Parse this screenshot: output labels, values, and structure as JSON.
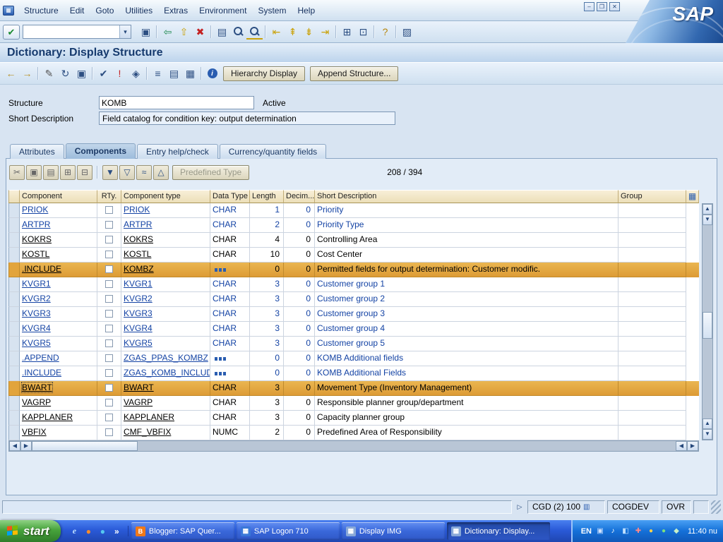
{
  "window": {
    "logo_text": "SAP",
    "controls": [
      {
        "name": "minimize-button",
        "glyph": "–"
      },
      {
        "name": "restore-button",
        "glyph": "❐"
      },
      {
        "name": "close-button",
        "glyph": "✕"
      }
    ]
  },
  "menubar": {
    "items": [
      "Structure",
      "Edit",
      "Goto",
      "Utilities",
      "Extras",
      "Environment",
      "System",
      "Help"
    ]
  },
  "toolbar": {
    "enter_glyph": "✔",
    "command_value": "",
    "dropdown_glyph": "▾",
    "icons": [
      {
        "name": "save-icon",
        "glyph": "▣",
        "color": "#2d4f82"
      },
      {
        "sep": true
      },
      {
        "name": "back-icon",
        "glyph": "⇦",
        "color": "#1e8a50"
      },
      {
        "name": "exit-icon",
        "glyph": "⇧",
        "color": "#caa20a"
      },
      {
        "name": "cancel-icon",
        "glyph": "✖",
        "color": "#c42222"
      },
      {
        "sep": true
      },
      {
        "name": "print-icon",
        "glyph": "▤",
        "color": "#2d4f82"
      },
      {
        "name": "find-icon",
        "css": "mag"
      },
      {
        "name": "find-next-icon",
        "css": "mag plus"
      },
      {
        "sep": true
      },
      {
        "name": "first-page-icon",
        "glyph": "⇤",
        "color": "#caa20a"
      },
      {
        "name": "previous-page-icon",
        "glyph": "⇞",
        "color": "#caa20a"
      },
      {
        "name": "next-page-icon",
        "glyph": "⇟",
        "color": "#caa20a"
      },
      {
        "name": "last-page-icon",
        "glyph": "⇥",
        "color": "#caa20a"
      },
      {
        "sep": true
      },
      {
        "name": "new-session-icon",
        "glyph": "⊞",
        "color": "#2d4f82"
      },
      {
        "name": "create-shortcut-icon",
        "glyph": "⊡",
        "color": "#2d4f82"
      },
      {
        "sep": true
      },
      {
        "name": "help-icon",
        "glyph": "?",
        "color": "#b8860b"
      },
      {
        "sep": true
      },
      {
        "name": "layout-menu-icon",
        "glyph": "▨",
        "color": "#2d4f82"
      }
    ]
  },
  "page": {
    "title": "Dictionary: Display Structure"
  },
  "app_toolbar": {
    "icons": [
      {
        "name": "back-icon",
        "glyph": "←",
        "color": "#b8922a"
      },
      {
        "name": "forward-icon",
        "glyph": "→",
        "color": "#b8922a"
      },
      {
        "sep": true
      },
      {
        "name": "display-change-icon",
        "glyph": "✎",
        "color": "#555555"
      },
      {
        "name": "refresh-icon",
        "glyph": "↻",
        "color": "#2d4f82"
      },
      {
        "name": "copy-icon",
        "glyph": "▣",
        "color": "#2d4f82"
      },
      {
        "sep": true
      },
      {
        "name": "check-icon",
        "glyph": "✔",
        "color": "#2d4f82"
      },
      {
        "name": "activate-icon",
        "glyph": "!",
        "color": "#c42222"
      },
      {
        "name": "where-used-icon",
        "glyph": "◈",
        "color": "#2d4f82"
      },
      {
        "sep": true
      },
      {
        "name": "runtime-object-icon",
        "glyph": "≡",
        "color": "#2d4f82"
      },
      {
        "name": "indexes-icon",
        "glyph": "▤",
        "color": "#2d4f82"
      },
      {
        "name": "technical-settings-icon",
        "glyph": "▦",
        "color": "#2d4f82"
      },
      {
        "sep": true
      },
      {
        "name": "info-icon",
        "css": "info"
      }
    ],
    "hierarchy_button": "Hierarchy Display",
    "append_button": "Append Structure..."
  },
  "form": {
    "structure_label": "Structure",
    "structure_value": "KOMB",
    "active_label": "Active",
    "short_desc_label": "Short Description",
    "short_desc_value": "Field catalog for condition key: output determination"
  },
  "tabs": {
    "items": [
      "Attributes",
      "Components",
      "Entry help/check",
      "Currency/quantity fields"
    ],
    "active_index": 1
  },
  "components_toolbar": {
    "icons": [
      {
        "name": "cut-icon",
        "glyph": "✂",
        "color": "#666666"
      },
      {
        "name": "copy-icon",
        "glyph": "▣",
        "color": "#666666"
      },
      {
        "name": "paste-icon",
        "glyph": "▤",
        "color": "#666666"
      },
      {
        "name": "insert-row-icon",
        "glyph": "⊞",
        "color": "#666666"
      },
      {
        "name": "delete-row-icon",
        "glyph": "⊟",
        "color": "#666666"
      },
      {
        "sep": true
      },
      {
        "name": "select-all-icon",
        "glyph": "▼",
        "color": "#2d4f82"
      },
      {
        "name": "filter-icon",
        "glyph": "▽",
        "color": "#2d4f82"
      },
      {
        "name": "sort-icon",
        "glyph": "≈",
        "color": "#2d4f82"
      },
      {
        "name": "move-up-icon",
        "glyph": "△",
        "color": "#2d4f82"
      }
    ],
    "predefined_type_label": "Predefined Type",
    "position": "208 / 394"
  },
  "table": {
    "headers": [
      "Component",
      "RTy.",
      "Component type",
      "Data Type",
      "Length",
      "Decim...",
      "Short Description",
      "Group"
    ],
    "settings_glyph": "▦",
    "rows": [
      {
        "component": "PRIOK",
        "rty": false,
        "ctype": "PRIOK",
        "dtype": "CHAR",
        "dtype_icon": false,
        "length": "1",
        "decimals": "0",
        "description": "Priority",
        "color": "blue",
        "highlight": false,
        "selected": false
      },
      {
        "component": "ARTPR",
        "rty": false,
        "ctype": "ARTPR",
        "dtype": "CHAR",
        "dtype_icon": false,
        "length": "2",
        "decimals": "0",
        "description": "Priority Type",
        "color": "blue",
        "highlight": false,
        "selected": false
      },
      {
        "component": "KOKRS",
        "rty": false,
        "ctype": "KOKRS",
        "dtype": "CHAR",
        "dtype_icon": false,
        "length": "4",
        "decimals": "0",
        "description": "Controlling Area",
        "color": "black",
        "highlight": false,
        "selected": false
      },
      {
        "component": "KOSTL",
        "rty": false,
        "ctype": "KOSTL",
        "dtype": "CHAR",
        "dtype_icon": false,
        "length": "10",
        "decimals": "0",
        "description": "Cost Center",
        "color": "black",
        "highlight": false,
        "selected": false
      },
      {
        "component": ".INCLUDE",
        "rty": false,
        "ctype": "KOMBZ",
        "dtype": "",
        "dtype_icon": true,
        "length": "0",
        "decimals": "0",
        "description": "Permitted fields for output determination: Customer modific.",
        "color": "black",
        "highlight": true,
        "selected": false
      },
      {
        "component": "KVGR1",
        "rty": false,
        "ctype": "KVGR1",
        "dtype": "CHAR",
        "dtype_icon": false,
        "length": "3",
        "decimals": "0",
        "description": "Customer group 1",
        "color": "blue",
        "highlight": false,
        "selected": false
      },
      {
        "component": "KVGR2",
        "rty": false,
        "ctype": "KVGR2",
        "dtype": "CHAR",
        "dtype_icon": false,
        "length": "3",
        "decimals": "0",
        "description": "Customer group 2",
        "color": "blue",
        "highlight": false,
        "selected": false
      },
      {
        "component": "KVGR3",
        "rty": false,
        "ctype": "KVGR3",
        "dtype": "CHAR",
        "dtype_icon": false,
        "length": "3",
        "decimals": "0",
        "description": "Customer group 3",
        "color": "blue",
        "highlight": false,
        "selected": false
      },
      {
        "component": "KVGR4",
        "rty": false,
        "ctype": "KVGR4",
        "dtype": "CHAR",
        "dtype_icon": false,
        "length": "3",
        "decimals": "0",
        "description": "Customer group 4",
        "color": "blue",
        "highlight": false,
        "selected": false
      },
      {
        "component": "KVGR5",
        "rty": false,
        "ctype": "KVGR5",
        "dtype": "CHAR",
        "dtype_icon": false,
        "length": "3",
        "decimals": "0",
        "description": "Customer group 5",
        "color": "blue",
        "highlight": false,
        "selected": false
      },
      {
        "component": ".APPEND",
        "rty": false,
        "ctype": "ZGAS_PPAS_KOMBZ",
        "dtype": "",
        "dtype_icon": true,
        "length": "0",
        "decimals": "0",
        "description": "KOMB Additional fields",
        "color": "blue",
        "highlight": false,
        "selected": false
      },
      {
        "component": ".INCLUDE",
        "rty": false,
        "ctype": "ZGAS_KOMB_INCLUDE",
        "dtype": "",
        "dtype_icon": true,
        "length": "0",
        "decimals": "0",
        "description": "KOMB Additional Fields",
        "color": "blue",
        "highlight": false,
        "selected": false
      },
      {
        "component": "BWART",
        "rty": false,
        "ctype": "BWART",
        "dtype": "CHAR",
        "dtype_icon": false,
        "length": "3",
        "decimals": "0",
        "description": "Movement Type (Inventory Management)",
        "color": "black",
        "highlight": true,
        "selected": true
      },
      {
        "component": "VAGRP",
        "rty": false,
        "ctype": "VAGRP",
        "dtype": "CHAR",
        "dtype_icon": false,
        "length": "3",
        "decimals": "0",
        "description": "Responsible planner group/department",
        "color": "black",
        "highlight": false,
        "selected": false
      },
      {
        "component": "KAPPLANER",
        "rty": false,
        "ctype": "KAPPLANER",
        "dtype": "CHAR",
        "dtype_icon": false,
        "length": "3",
        "decimals": "0",
        "description": "Capacity planner group",
        "color": "black",
        "highlight": false,
        "selected": false
      },
      {
        "component": "VBFIX",
        "rty": false,
        "ctype": "CMF_VBFIX",
        "dtype": "NUMC",
        "dtype_icon": false,
        "length": "2",
        "decimals": "0",
        "description": "Predefined Area of Responsibility",
        "color": "black",
        "highlight": false,
        "selected": false
      }
    ]
  },
  "scrollbar": {
    "up": "▲",
    "down": "▼",
    "left": "◀",
    "right": "▶"
  },
  "statusbar": {
    "expand_glyph": "▷",
    "system_field": "CGD (2) 100",
    "system_icon_glyph": "▥",
    "server_field": "COGDEV",
    "mode_field": "OVR"
  },
  "taskbar": {
    "start_label": "start",
    "quick_launch": [
      {
        "name": "ie-icon",
        "glyph": "e",
        "color": "#bfe0ff"
      },
      {
        "name": "firefox-icon",
        "glyph": "●",
        "color": "#ff8c28"
      },
      {
        "name": "messenger-icon",
        "glyph": "●",
        "color": "#55c8f0"
      },
      {
        "name": "overflow-chevron-icon",
        "glyph": "»",
        "color": "#ffffff"
      }
    ],
    "tasks": [
      {
        "label": "Blogger: SAP Quer...",
        "icon_glyph": "B",
        "icon_color": "#f07818",
        "active": false
      },
      {
        "label": "SAP Logon 710",
        "icon_glyph": "▦",
        "icon_color": "#3a78d8",
        "active": false
      },
      {
        "label": "Display IMG",
        "icon_glyph": "▦",
        "icon_color": "#88a8d8",
        "active": false
      },
      {
        "label": "Dictionary: Display...",
        "icon_glyph": "▦",
        "icon_color": "#88a8d8",
        "active": true
      }
    ],
    "tray": {
      "language": "EN",
      "icons": [
        {
          "name": "tray-display-icon",
          "glyph": "▣",
          "color": "#cfe2ff"
        },
        {
          "name": "tray-volume-icon",
          "glyph": "♪",
          "color": "#ffffff"
        },
        {
          "name": "tray-network-icon",
          "glyph": "◧",
          "color": "#bfe0ff"
        },
        {
          "name": "tray-antivirus-icon",
          "glyph": "✚",
          "color": "#ff8888"
        },
        {
          "name": "tray-update-icon",
          "glyph": "●",
          "color": "#ffd24a"
        },
        {
          "name": "tray-messenger-icon",
          "glyph": "●",
          "color": "#7de07d"
        },
        {
          "name": "tray-safely-remove-icon",
          "glyph": "◆",
          "color": "#c8f0c8"
        }
      ],
      "clock": "11:40 nu"
    }
  }
}
